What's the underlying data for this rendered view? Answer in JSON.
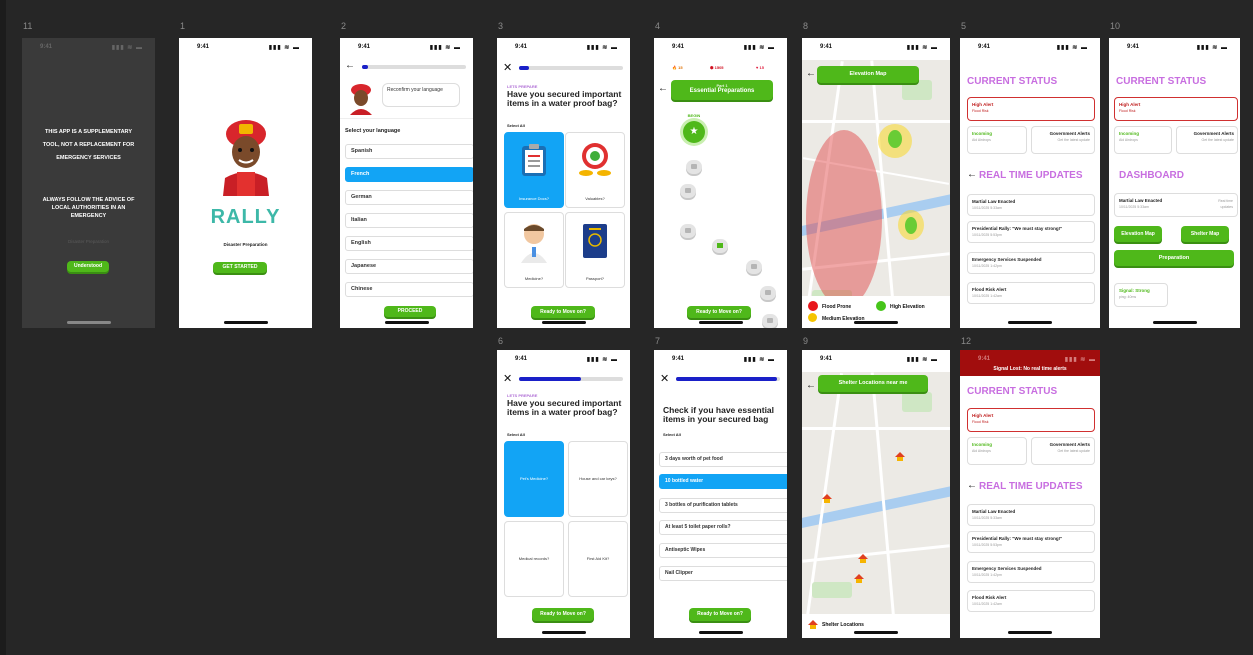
{
  "status_bar": {
    "time": "9:41",
    "icons": "▮▮▮ ≋ ▬"
  },
  "frame_labels": {
    "f11": "11",
    "f1": "1",
    "f2": "2",
    "f3": "3",
    "f4": "4",
    "f8": "8",
    "f5": "5",
    "f10": "10",
    "f6": "6",
    "f7": "7",
    "f9": "9",
    "f12": "12"
  },
  "disclaimer": {
    "line1": "THIS APP IS A SUPPLEMENTARY TOOL, NOT A REPLACEMENT FOR EMERGENCY SERVICES",
    "line2": "ALWAYS FOLLOW THE ADVICE OF LOCAL AUTHORITIES IN AN EMERGENCY",
    "ghost": "Disaster Preparation",
    "button": "Understood"
  },
  "splash": {
    "logo": "RALLY",
    "subtitle": "Disaster Preparation",
    "button": "GET STARTED"
  },
  "language": {
    "bubble": "Reconfirm your language",
    "heading": "Select your language",
    "options": [
      "Spanish",
      "French",
      "German",
      "Italian",
      "English",
      "Japanese",
      "Chinese"
    ],
    "selected_index": 1,
    "button": "PROCEED",
    "progress": 0.05
  },
  "prep_items": {
    "kicker": "LETS PREPARE",
    "question": "Have you secured important items in a water proof bag?",
    "select_all": "Select All",
    "cards": [
      "Insurance Docs?",
      "Valuables?",
      "Medicine?",
      "Passport?"
    ],
    "button": "Ready to Move on?",
    "progress": 0.1
  },
  "path": {
    "stats": {
      "streak": "15",
      "gems": "1505",
      "lives": "15"
    },
    "unit": "Part 1",
    "title": "Essential Preparations",
    "begin": "BEGIN"
  },
  "elevation": {
    "button": "Elevation Map",
    "legend": {
      "flood": "Flood Prone",
      "high": "High Elevation",
      "medium": "Medium Elevation"
    },
    "colors": {
      "flood": "#e8161b",
      "high": "#46c51a",
      "medium": "#f5c400"
    }
  },
  "status_main": {
    "title": "CURRENT STATUS",
    "alert_title": "High Alert",
    "alert_sub": "Flood Risk",
    "incoming_title": "Incoming",
    "incoming_sub": "Aid Airdrops",
    "gov_title": "Government Alerts",
    "gov_sub": "Get the latest update",
    "updates_title": "REAL TIME UPDATES",
    "updates": [
      {
        "title": "Martial Law Enacted",
        "date": "10/11/2025  5:33am"
      },
      {
        "title": "Presidential Rally: \"We must stay strong!\"",
        "date": "10/11/2025  5:53pm"
      },
      {
        "title": "Emergency Services Suspended",
        "date": "10/11/2025  1:42pm"
      },
      {
        "title": "Flood Risk Alert",
        "date": "10/11/2025  1:42am"
      }
    ]
  },
  "dashboard": {
    "title": "CURRENT STATUS",
    "alert_title": "High Alert",
    "alert_sub": "Flood Risk",
    "incoming_title": "Incoming",
    "incoming_sub": "Aid Airdrops",
    "gov_title": "Government Alerts",
    "gov_sub": "Get the latest update",
    "dash_title": "DASHBOARD",
    "latest_title": "Martial Law Enacted",
    "latest_date": "10/11/2025  5:33am",
    "latest_tag": "Real time updates",
    "btn_elev": "Elevation Map",
    "btn_shelter": "Shelter Map",
    "btn_prep": "Preparation",
    "signal_title": "Signal: Strong",
    "signal_sub": "ping: 40ms"
  },
  "pet_items": {
    "kicker": "LETS PREPARE",
    "question": "Have you secured important items in a water proof bag?",
    "select_all": "Select All",
    "cards": [
      "Pet's Medicine?",
      "House and car keys?",
      "Medical records?",
      "First Aid Kit?"
    ],
    "button": "Ready to Move on?",
    "progress": 0.6
  },
  "checklist": {
    "question": "Check if you have essential items in your secured bag",
    "select_all": "Select All",
    "items": [
      "3 days worth of pet food",
      "10 bottled water",
      "3 bottles of purification tablets",
      "At least 5 toilet paper rolls?",
      "Antiseptic Wipes",
      "Nail Clipper"
    ],
    "selected_index": 1,
    "button": "Ready to Move on?",
    "progress": 0.98
  },
  "shelter": {
    "button": "Shelter Locations near me",
    "legend": "Shelter Locations"
  },
  "signal_lost": {
    "banner": "Signal Lost: No real time alerts",
    "title": "CURRENT STATUS",
    "alert_title": "High Alert",
    "alert_sub": "Flood Risk",
    "incoming_title": "Incoming",
    "incoming_sub": "Aid Airdrops",
    "gov_title": "Government Alerts",
    "gov_sub": "Get the latest update",
    "updates_title": "REAL TIME UPDATES",
    "updates": [
      {
        "title": "Martial Law Enacted",
        "date": "10/11/2025  5:33am"
      },
      {
        "title": "Presidential Rally: \"We must stay strong!\"",
        "date": "10/11/2025  5:53pm"
      },
      {
        "title": "Emergency Services Suspended",
        "date": "10/11/2025  1:42pm"
      },
      {
        "title": "Flood Risk Alert",
        "date": "10/11/2025  1:42am"
      }
    ]
  },
  "icons": {
    "back": "←",
    "close": "✕"
  },
  "colors": {
    "green": "#4fb81a",
    "blue": "#12a4f5",
    "purple": "#c86ee0",
    "alert_red": "#d03030",
    "banner": "#a10d0d",
    "progress": "#1a20c8"
  }
}
